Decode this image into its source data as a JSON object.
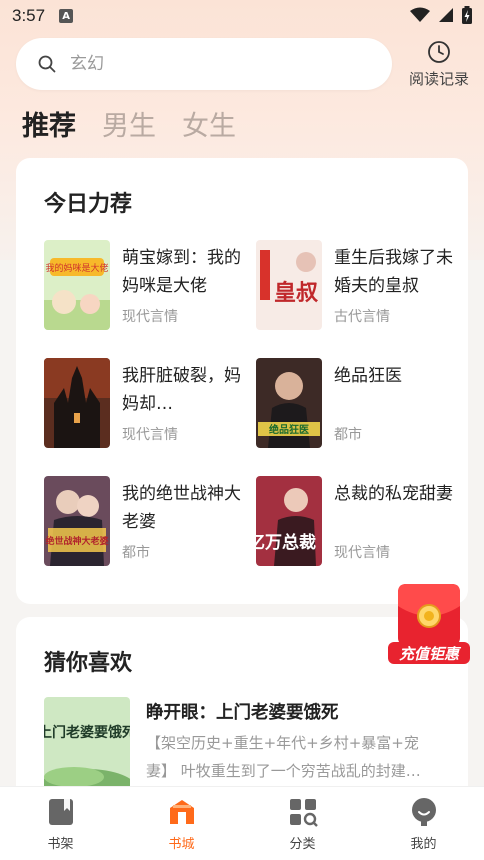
{
  "status": {
    "time": "3:57"
  },
  "search": {
    "placeholder": "玄幻"
  },
  "history": {
    "label": "阅读记录"
  },
  "tabs": [
    {
      "label": "推荐"
    },
    {
      "label": "男生"
    },
    {
      "label": "女生"
    }
  ],
  "recommend": {
    "title": "今日力荐",
    "items": [
      {
        "title": "萌宝嫁到：我的妈咪是大佬",
        "genre": "现代言情",
        "cover_text": "我的妈咪是大佬",
        "cover_color": "#cfe4b8"
      },
      {
        "title": "重生后我嫁了未婚夫的皇叔",
        "genre": "古代言情",
        "cover_text": "皇叔",
        "cover_color": "#f4e3dc"
      },
      {
        "title": "我肝脏破裂，妈妈却…",
        "genre": "现代言情",
        "cover_text": "",
        "cover_color": "#3a2a24"
      },
      {
        "title": "绝品狂医",
        "genre": "都市",
        "cover_text": "绝品狂医",
        "cover_color": "#5a3a30"
      },
      {
        "title": "我的绝世战神大老婆",
        "genre": "都市",
        "cover_text": "绝世战神大老婆",
        "cover_color": "#4a3440"
      },
      {
        "title": "总裁的私宠甜妻",
        "genre": "现代言情",
        "cover_text": "亿万总裁",
        "cover_color": "#7a1e2a"
      }
    ]
  },
  "guess": {
    "title": "猜你喜欢",
    "book": {
      "title": "睁开眼：上门老婆要饿死",
      "desc": "【架空历史+重生+年代+乡村+暴富+宠妻】 叶牧重生到了一个穷苦战乱的封建…",
      "cover_text": "上门老婆要饿死"
    }
  },
  "promo": {
    "label": "充值钜惠"
  },
  "nav": [
    {
      "label": "书架",
      "icon": "bookshelf-icon"
    },
    {
      "label": "书城",
      "icon": "store-icon"
    },
    {
      "label": "分类",
      "icon": "category-icon"
    },
    {
      "label": "我的",
      "icon": "profile-icon"
    }
  ],
  "colors": {
    "accent": "#ff6a1a",
    "promo": "#e8232f"
  }
}
